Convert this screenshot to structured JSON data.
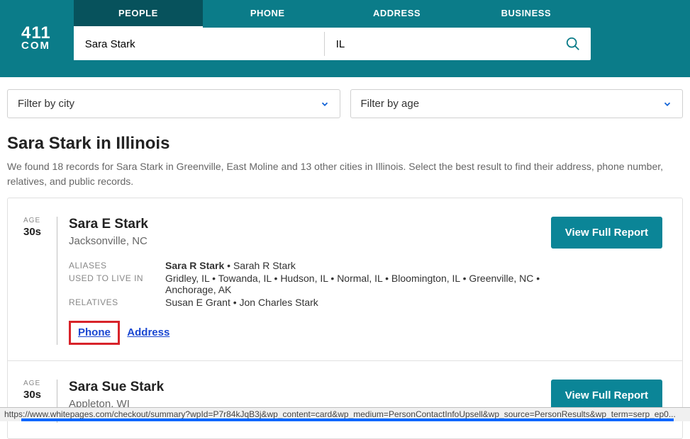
{
  "logo": {
    "line1": "411",
    "line2": "COM"
  },
  "tabs": [
    {
      "label": "PEOPLE",
      "active": true
    },
    {
      "label": "PHONE",
      "active": false
    },
    {
      "label": "ADDRESS",
      "active": false
    },
    {
      "label": "BUSINESS",
      "active": false
    }
  ],
  "search": {
    "name_value": "Sara Stark",
    "location_value": "IL"
  },
  "filters": {
    "city_label": "Filter by city",
    "age_label": "Filter by age"
  },
  "page": {
    "title": "Sara Stark in Illinois",
    "subtitle": "We found 18 records for Sara Stark in Greenville, East Moline and 13 other cities in Illinois. Select the best result to find their address, phone number, relatives, and public records."
  },
  "labels": {
    "age": "AGE",
    "aliases": "ALIASES",
    "used_to_live": "USED TO LIVE IN",
    "relatives": "RELATIVES",
    "phone": "Phone",
    "address": "Address",
    "view_report": "View Full Report"
  },
  "results": [
    {
      "age": "30s",
      "name": "Sara E Stark",
      "location": "Jacksonville, NC",
      "aliases_bold": "Sara R Stark",
      "aliases_rest": " • Sarah R Stark",
      "lived_in": "Gridley, IL • Towanda, IL • Hudson, IL • Normal, IL • Bloomington, IL • Greenville, NC • Anchorage, AK",
      "relatives": "Susan E Grant • Jon Charles Stark",
      "show_details": true
    },
    {
      "age": "30s",
      "name": "Sara Sue Stark",
      "location": "Appleton, WI",
      "show_details": false
    }
  ],
  "statusbar_url": "https://www.whitepages.com/checkout/summary?wpId=P7r84kJqB3j&wp_content=card&wp_medium=PersonContactInfoUpsell&wp_source=PersonResults&wp_term=serp_ep0..."
}
